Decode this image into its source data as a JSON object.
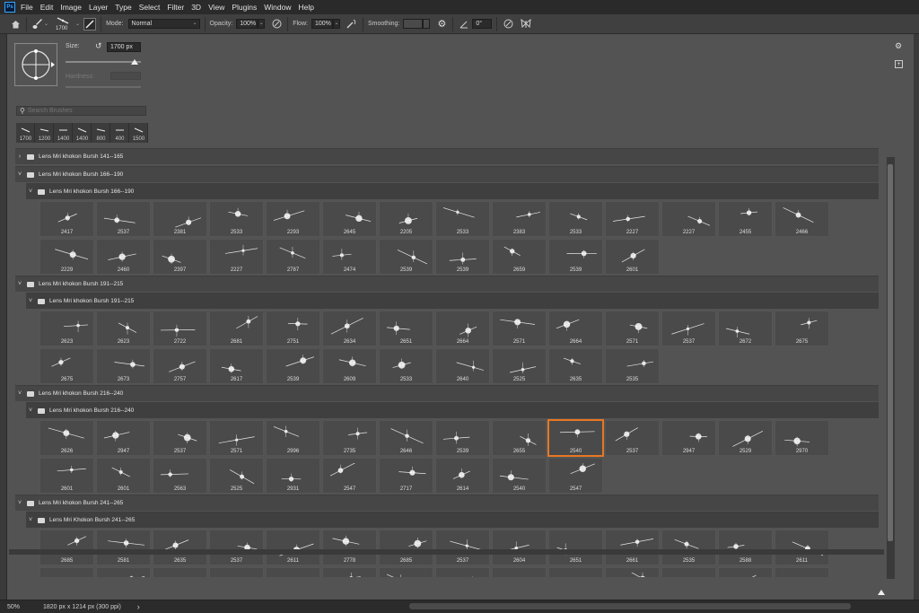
{
  "menu": [
    "File",
    "Edit",
    "Image",
    "Layer",
    "Type",
    "Select",
    "Filter",
    "3D",
    "View",
    "Plugins",
    "Window",
    "Help"
  ],
  "options": {
    "brush_size_label": "1700",
    "mode_label": "Mode:",
    "mode_value": "Normal",
    "opacity_label": "Opacity:",
    "opacity_value": "100%",
    "flow_label": "Flow:",
    "flow_value": "100%",
    "smoothing_label": "Smoothing:",
    "angle_value": "0°"
  },
  "panel": {
    "size_label": "Size:",
    "size_value": "1700 px",
    "hardness_label": "Hardness:",
    "search_placeholder": "Search Brushes",
    "recent": [
      "1700",
      "1200",
      "1400",
      "1400",
      "800",
      "400",
      "1500"
    ]
  },
  "groups": [
    {
      "label": "Lens Mri khokon Bursh 141--165",
      "expanded": false
    },
    {
      "label": "Lens Mri khokon Bursh 166--190",
      "expanded": true
    },
    {
      "label": "Lens Mri khokon Bursh 166--190",
      "expanded": true
    },
    {
      "label": "Lens Mri khokon Bursh 191--215",
      "expanded": true
    },
    {
      "label": "Lens Mri khokon Bursh 191--215",
      "expanded": true
    },
    {
      "label": "Lens Mri khokon Bursh 216--240",
      "expanded": true
    },
    {
      "label": "Lens Mri khokon Bursh 216--240",
      "expanded": true
    },
    {
      "label": "Lens Mri khokon Bursh 241--265",
      "expanded": true
    },
    {
      "label": "Lens Mri Khokon Bursh 241--265",
      "expanded": true
    }
  ],
  "brush_rows": [
    [
      "2417",
      "2537",
      "2381",
      "2533",
      "2293",
      "2645",
      "2205",
      "2533",
      "2383",
      "2533",
      "2227",
      "2227",
      "2455",
      "2466"
    ],
    [
      "2229",
      "2460",
      "2397",
      "2227",
      "2787",
      "2474",
      "2539",
      "2539",
      "2659",
      "2539",
      "2601"
    ],
    [
      "2623",
      "2623",
      "2722",
      "2681",
      "2751",
      "2634",
      "2651",
      "2664",
      "2571",
      "2664",
      "2571",
      "2537",
      "2672",
      "2675"
    ],
    [
      "2675",
      "2673",
      "2757",
      "2617",
      "2539",
      "2609",
      "2533",
      "2640",
      "2525",
      "2635",
      "2535"
    ],
    [
      "2626",
      "2947",
      "2537",
      "2571",
      "2996",
      "2735",
      "2646",
      "2539",
      "2655",
      "2540",
      "2537",
      "2947",
      "2529",
      "2970"
    ],
    [
      "2601",
      "2601",
      "2563",
      "2525",
      "2931",
      "2547",
      "2717",
      "2614",
      "2540",
      "2547"
    ],
    [
      "2685",
      "2581",
      "2635",
      "2537",
      "2611",
      "2778",
      "2685",
      "2537",
      "2604",
      "2651",
      "2661",
      "2535",
      "2588",
      "2611"
    ],
    [
      "",
      "",
      "",
      "",
      "",
      "",
      "",
      "",
      "",
      "",
      "",
      "",
      "",
      ""
    ]
  ],
  "selected_brush": {
    "row": 4,
    "col": 9
  },
  "status": {
    "zoom": "50%",
    "doc_info": "1820 px x 1214 px (300 ppi)"
  },
  "colors": {
    "selection": "#e87723",
    "ps_blue": "#31a8ff"
  }
}
